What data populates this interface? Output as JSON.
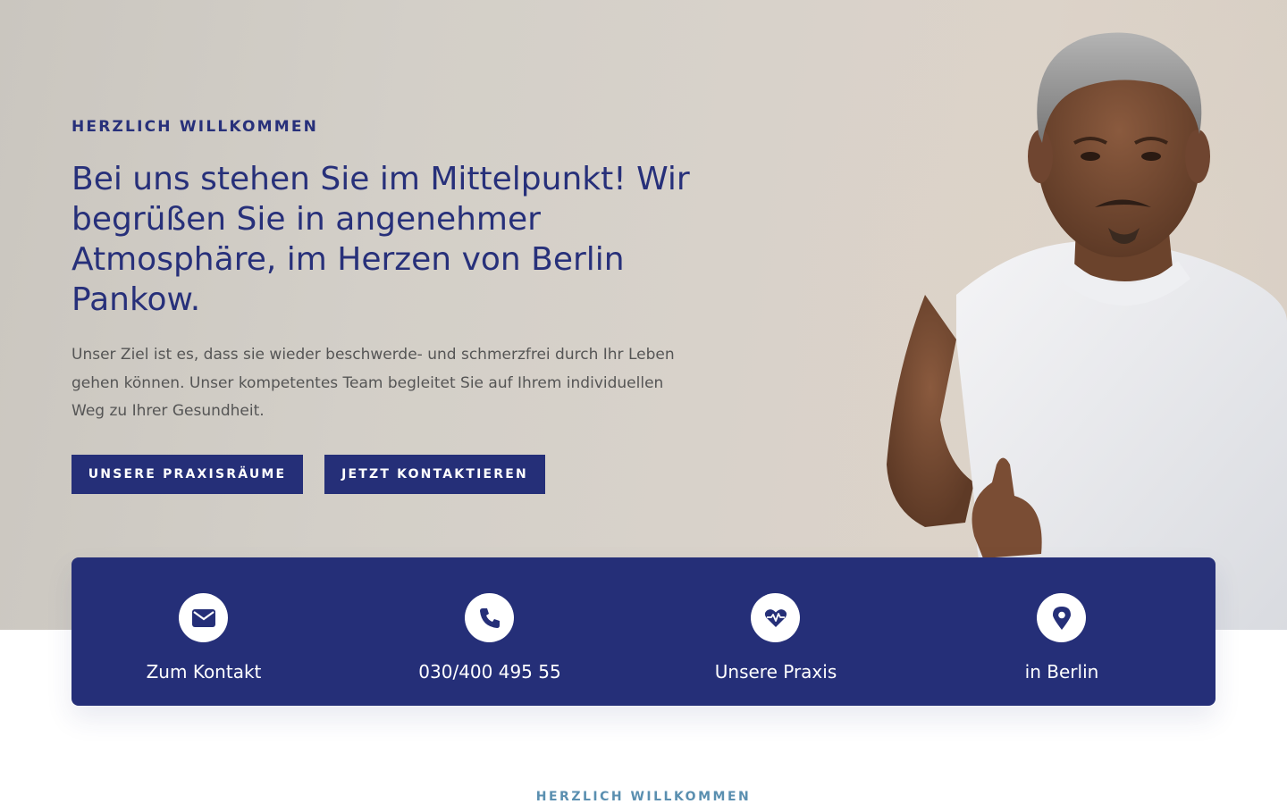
{
  "hero": {
    "kicker": "HERZLICH WILLKOMMEN",
    "headline": "Bei uns stehen Sie im Mittelpunkt! Wir begrüßen Sie in angenehmer Atmosphäre, im Herzen von Berlin Pankow.",
    "intro": "Unser Ziel ist es, dass sie wieder beschwerde- und schmerzfrei durch Ihr Leben gehen können. Unser kompetentes Team begleitet Sie auf Ihrem individuellen Weg zu Ihrer Gesundheit.",
    "buttons": {
      "praxis": "UNSERE PRAXISRÄUME",
      "kontakt": "JETZT KONTAKTIEREN"
    }
  },
  "infobar": {
    "items": [
      {
        "icon": "envelope-icon",
        "label": "Zum Kontakt"
      },
      {
        "icon": "phone-icon",
        "label": "030/400 495 55"
      },
      {
        "icon": "heartbeat-icon",
        "label": "Unsere Praxis"
      },
      {
        "icon": "map-pin-icon",
        "label": "in Berlin"
      }
    ]
  },
  "section": {
    "kicker": "HERZLICH WILLKOMMEN"
  },
  "colors": {
    "primary": "#252f78",
    "heading": "#27307a",
    "body_text": "#555555",
    "section_kicker": "#5a8fb0"
  }
}
